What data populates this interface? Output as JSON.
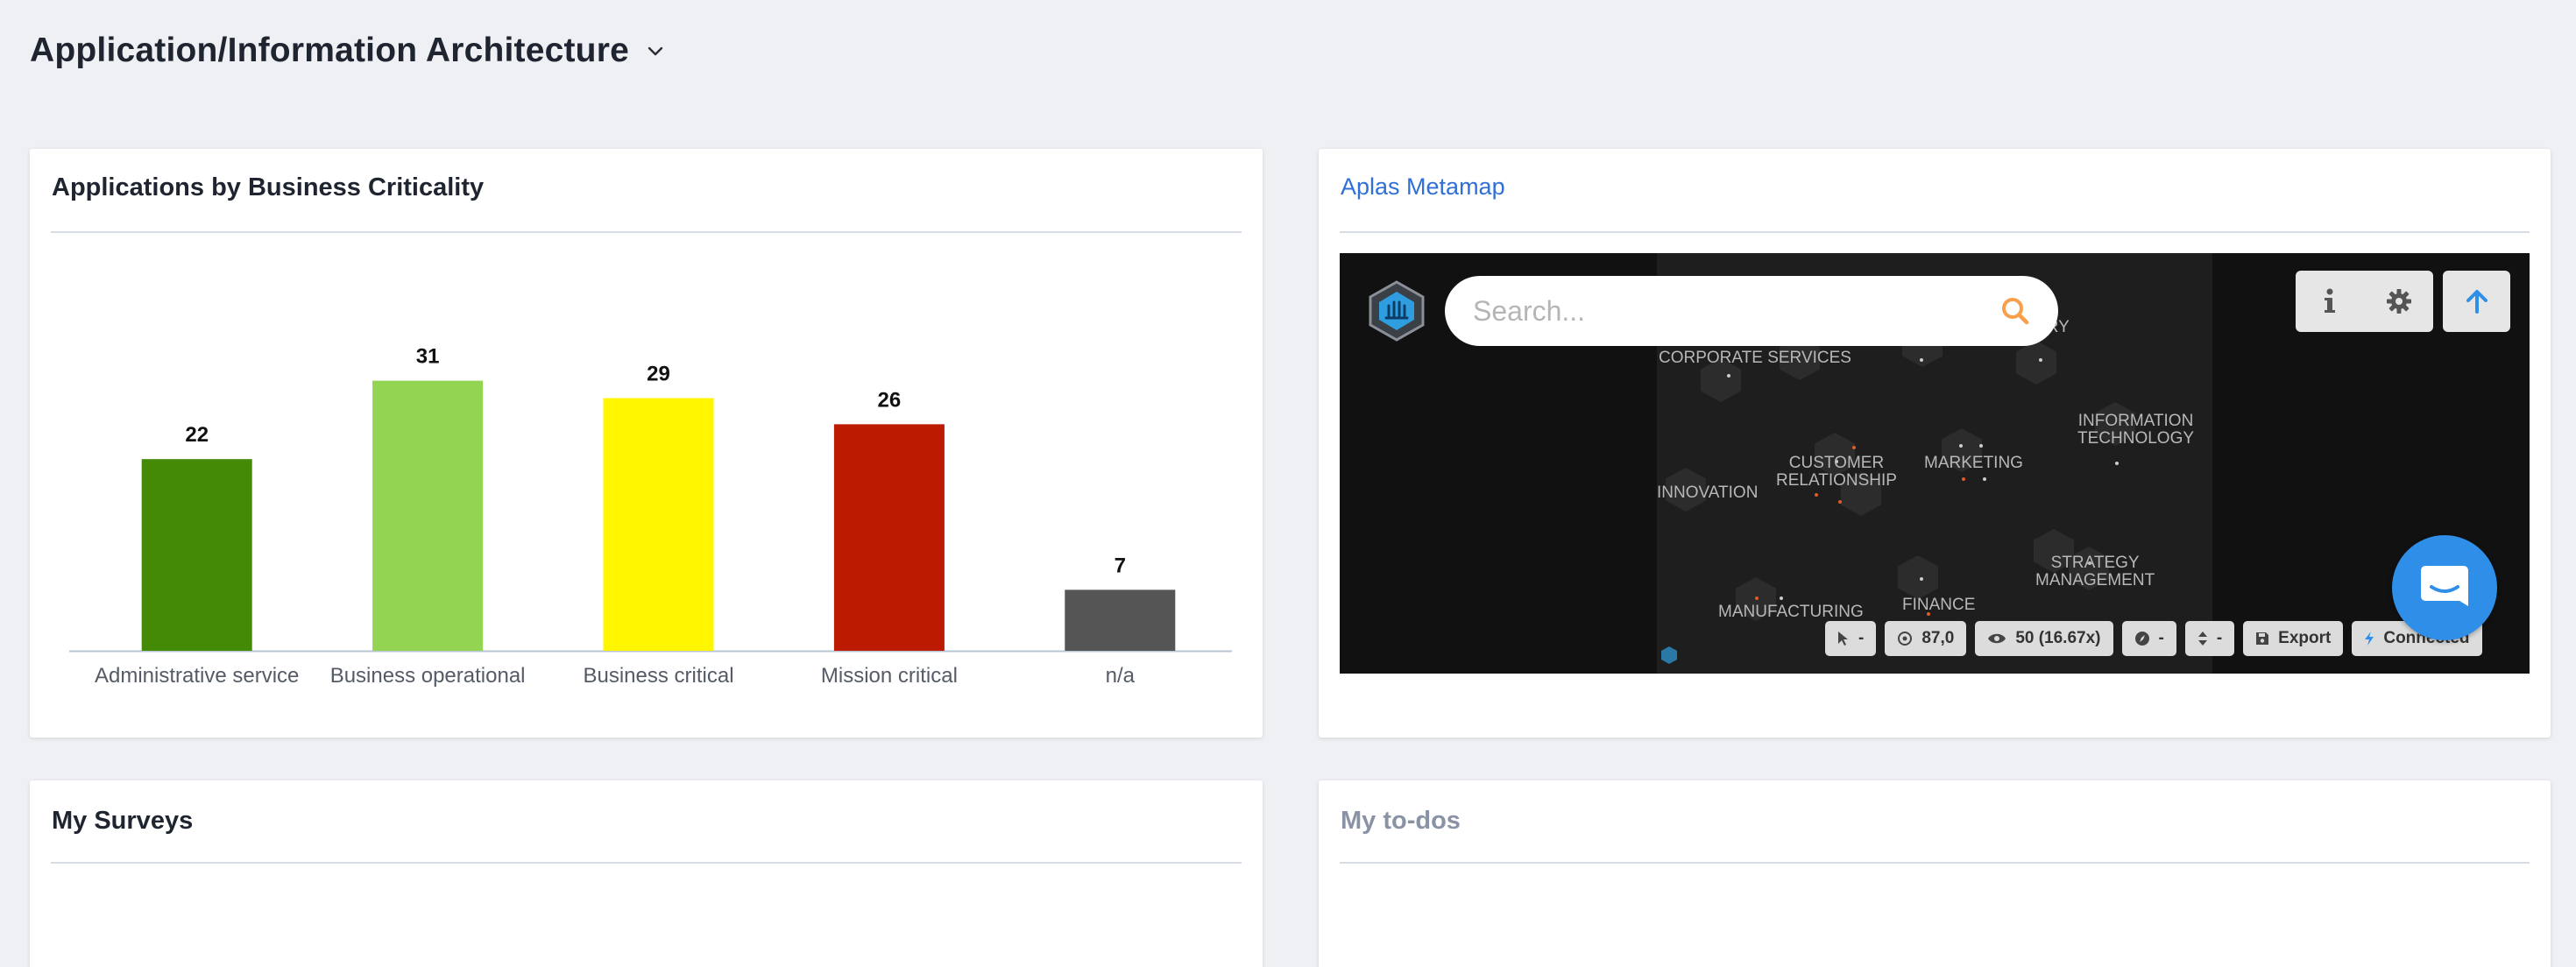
{
  "header": {
    "title": "Application/Information Architecture"
  },
  "chart_card": {
    "title": "Applications by Business Criticality"
  },
  "chart_data": {
    "type": "bar",
    "title": "Applications by Business Criticality",
    "categories": [
      "Administrative service",
      "Business operational",
      "Business critical",
      "Mission critical",
      "n/a"
    ],
    "values": [
      22,
      31,
      29,
      26,
      7
    ],
    "value_labels": [
      "22",
      "31",
      "29",
      "26",
      "7"
    ],
    "colors": [
      "#448a07",
      "#93d453",
      "#fff600",
      "#bd1a02",
      "#555555"
    ],
    "xlabel": "",
    "ylabel": "",
    "ylim": [
      0,
      38
    ],
    "grid": false
  },
  "metamap_card": {
    "title": "Aplas Metamap",
    "search_placeholder": "Search...",
    "map_labels": {
      "corporate": "CORPORATE SERVICES",
      "story": "ORY",
      "customer": "CUSTOMER\nRELATIONSHIP",
      "marketing": "MARKETING",
      "infotech": "INFORMATION\nTECHNOLOGY",
      "innovation": "INNOVATION",
      "strategy": "STRATEGY\nMANAGEMENT",
      "finance": "FINANCE",
      "manufacturing": "MANUFACTURING"
    },
    "status": {
      "pointer": "-",
      "position": "87,0",
      "view": "50 (16.67x)",
      "compass": "-",
      "sort": "-",
      "export": "Export",
      "connection": "Connected"
    },
    "accent": "#2f8fe8"
  },
  "surveys_card": {
    "title": "My Surveys"
  },
  "todos_card": {
    "title": "My to-dos"
  }
}
